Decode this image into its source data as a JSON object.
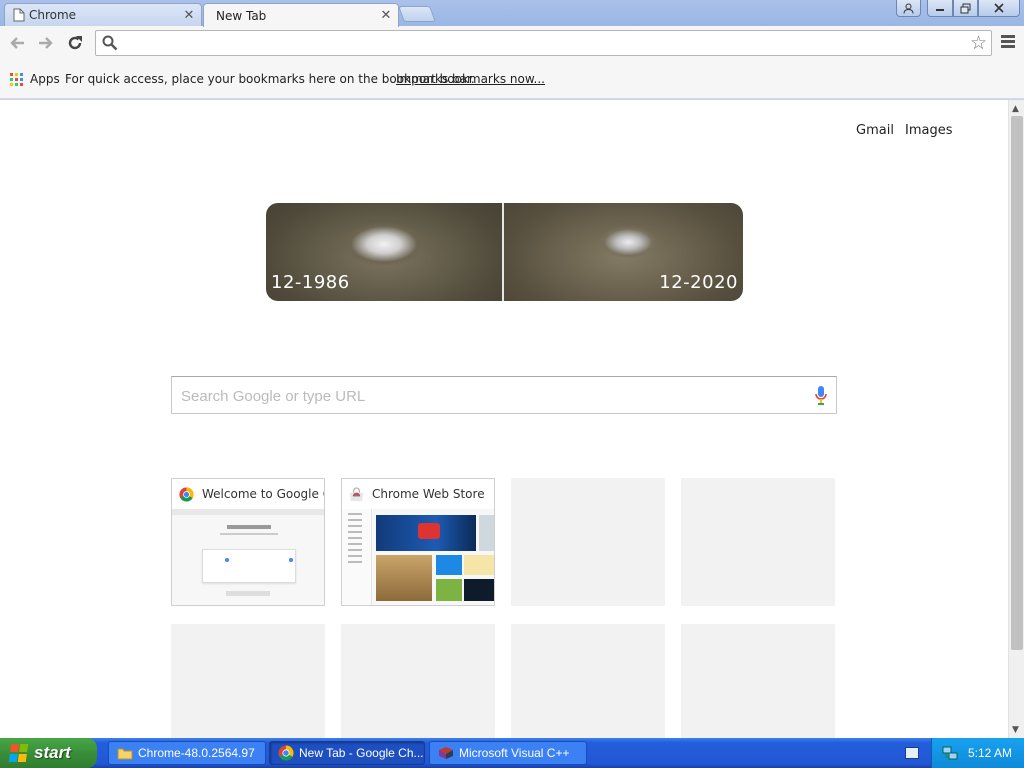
{
  "window": {
    "tabs": [
      {
        "label": "Chrome",
        "active": false
      },
      {
        "label": "New Tab",
        "active": true
      }
    ],
    "close_glyph": "✕"
  },
  "toolbar": {
    "address_value": "",
    "icons": [
      "back-arrow-icon",
      "forward-arrow-icon",
      "reload-icon",
      "search-icon",
      "star-icon",
      "menu-icon"
    ]
  },
  "bookmarks_bar": {
    "apps_label": "Apps",
    "hint": "For quick access, place your bookmarks here on the bookmarks bar.",
    "import_link": "Import bookmarks now..."
  },
  "ntp": {
    "gmail": "Gmail",
    "images": "Images",
    "doodle": {
      "left_year": "12-1986",
      "right_year": "12-2020"
    },
    "search_placeholder": "Search Google or type URL",
    "tiles": [
      {
        "title": "Welcome to Google Chrome",
        "filled": true
      },
      {
        "title": "Chrome Web Store",
        "filled": true
      },
      {
        "title": "",
        "filled": false
      },
      {
        "title": "",
        "filled": false
      },
      {
        "title": "",
        "filled": false
      },
      {
        "title": "",
        "filled": false
      },
      {
        "title": "",
        "filled": false
      },
      {
        "title": "",
        "filled": false
      }
    ]
  },
  "taskbar": {
    "start_label": "start",
    "tasks": [
      {
        "label": "Chrome-48.0.2564.97",
        "icon": "folder-icon"
      },
      {
        "label": "New Tab - Google Ch...",
        "icon": "chrome-icon"
      },
      {
        "label": "Microsoft Visual C++",
        "icon": "visual-studio-icon"
      }
    ],
    "clock": "5:12 AM"
  },
  "colors": {
    "taskbar_blue": "#245edb",
    "start_green": "#3a8f3a",
    "tray_blue": "#0f8ad8",
    "google_blue": "#4285f4"
  }
}
